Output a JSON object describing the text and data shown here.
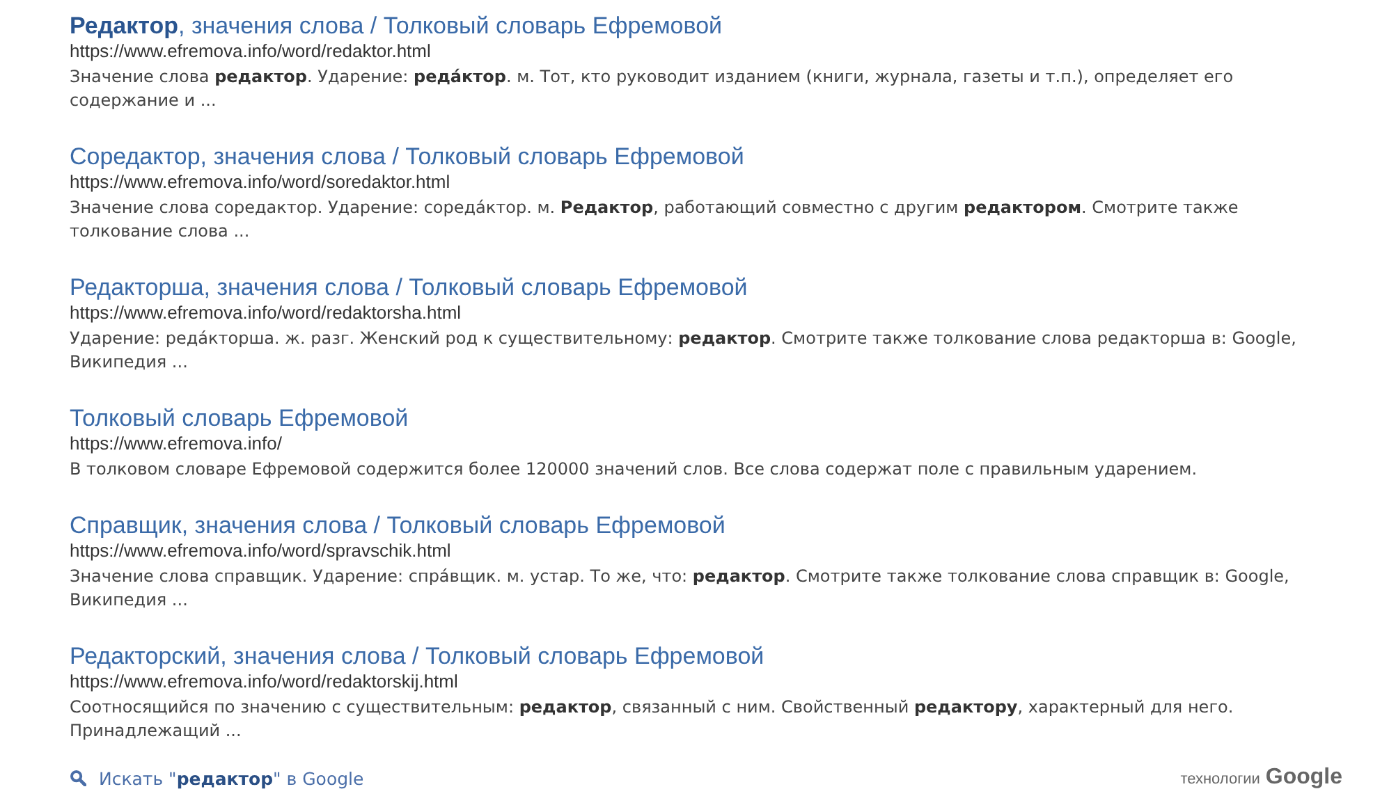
{
  "results": [
    {
      "title": "**Редактор**, значения слова / Толковый словарь Ефремовой",
      "url": "https://www.efremova.info/word/redaktor.html",
      "snippet": "Значение слова **редактор**. Ударение: **реда́ктор**. м. Тот, кто руководит изданием (книги, журнала, газеты и т.п.), определяет его содержание и ..."
    },
    {
      "title": "Соредактор, значения слова / Толковый словарь Ефремовой",
      "url": "https://www.efremova.info/word/soredaktor.html",
      "snippet": "Значение слова соредактор. Ударение: соредáктор. м. **Редактор**, работающий совместно с другим **редактором**. Смотрите также толкование слова ..."
    },
    {
      "title": "Редакторша, значения слова / Толковый словарь Ефремовой",
      "url": "https://www.efremova.info/word/redaktorsha.html",
      "snippet": "Ударение: редáкторша. ж. разг. Женский род к существительному: **редактор**. Смотрите также толкование слова редакторша в: Google, Википедия ..."
    },
    {
      "title": "Толковый словарь Ефремовой",
      "url": "https://www.efremova.info/",
      "snippet": "В толковом словаре Ефремовой содержится более 120000 значений слов. Все слова содержат поле с правильным ударением."
    },
    {
      "title": "Справщик, значения слова / Толковый словарь Ефремовой",
      "url": "https://www.efremova.info/word/spravschik.html",
      "snippet": "Значение слова справщик. Ударение: спрáвщик. м. устар. То же, что: **редактор**. Смотрите также толкование слова справщик в: Google, Википедия  ..."
    },
    {
      "title": "Редакторский, значения слова / Толковый словарь Ефремовой",
      "url": "https://www.efremova.info/word/redaktorskij.html",
      "snippet": "Соотносящийся по значению с существительным: **редактор**, связанный с ним. Свойственный **редактору**, характерный для него. Принадлежащий ..."
    }
  ],
  "footer": {
    "search_link": "Искать \"**редактор**\" в Google",
    "branding_label": "технологии",
    "branding_logo": "Google"
  }
}
